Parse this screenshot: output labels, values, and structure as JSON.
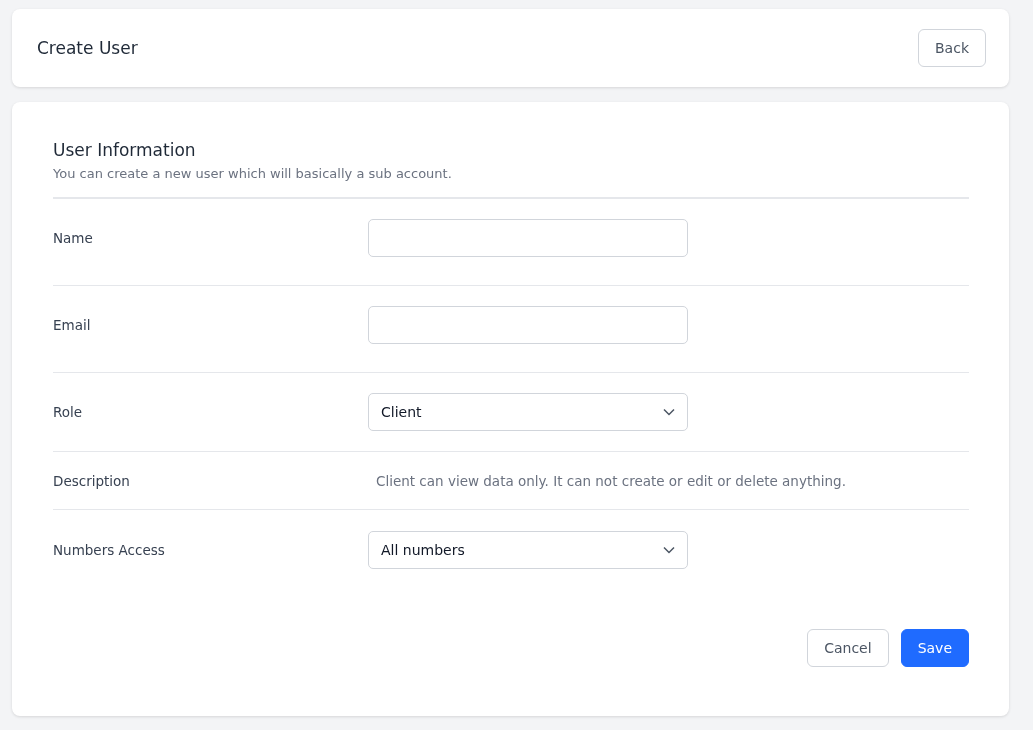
{
  "header": {
    "title": "Create User",
    "back_button": "Back"
  },
  "section": {
    "title": "User Information",
    "subtitle": "You can create a new user which will basically a sub account."
  },
  "fields": [
    {
      "kind": "input",
      "label": "Name"
    },
    {
      "kind": "input",
      "label": "Email"
    },
    {
      "kind": "select",
      "label": "Role",
      "value": "Client"
    },
    {
      "kind": "text",
      "label": "Description",
      "value": "Client can view data only. It can not create or edit or delete anything."
    },
    {
      "kind": "select",
      "label": "Numbers Access",
      "value": "All numbers"
    }
  ],
  "buttons": [
    {
      "kind": "secondary",
      "label": "Cancel"
    },
    {
      "kind": "primary",
      "label": "Save"
    }
  ]
}
